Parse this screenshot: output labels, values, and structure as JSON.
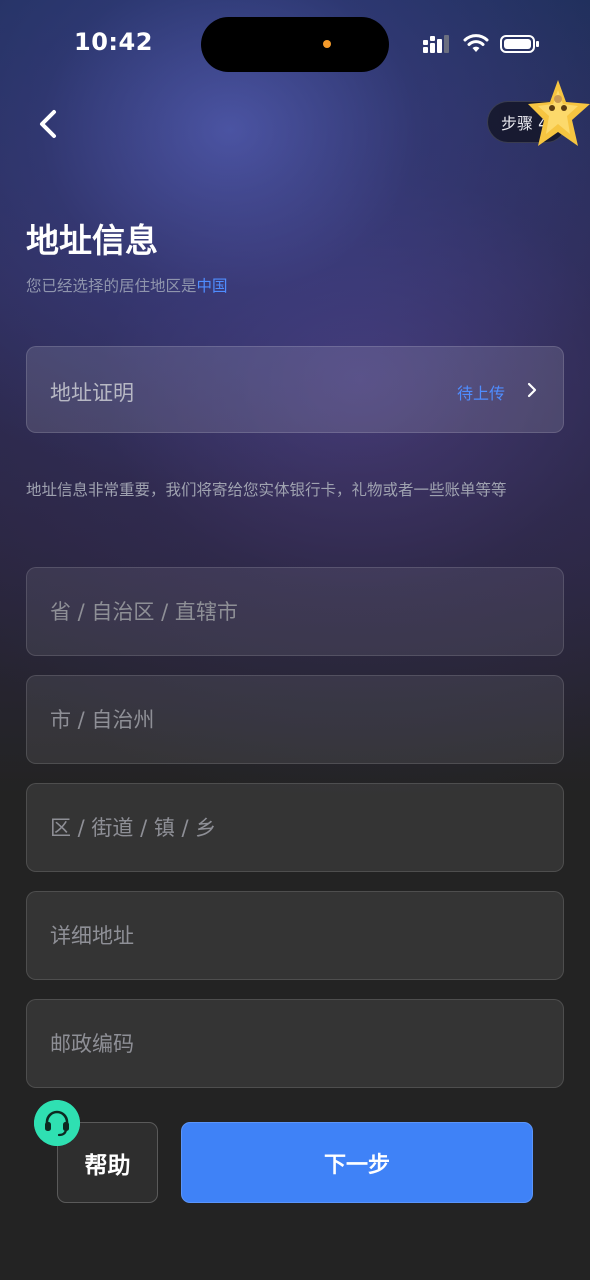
{
  "status_bar": {
    "time": "10:42"
  },
  "header": {
    "step_label": "步骤 4"
  },
  "page": {
    "title": "地址信息",
    "subtitle_prefix": "您已经选择的居住地区是",
    "country": "中国"
  },
  "address_proof": {
    "label": "地址证明",
    "status": "待上传"
  },
  "note": "地址信息非常重要，我们将寄给您实体银行卡，礼物或者一些账单等等",
  "fields": {
    "province": {
      "placeholder": "省 / 自治区 / 直辖市",
      "value": ""
    },
    "city": {
      "placeholder": "市 / 自治州",
      "value": ""
    },
    "district": {
      "placeholder": "区 / 街道 / 镇 / 乡",
      "value": ""
    },
    "detail": {
      "placeholder": "详细地址",
      "value": ""
    },
    "postcode": {
      "placeholder": "邮政编码",
      "value": ""
    }
  },
  "footer": {
    "help_label": "帮助",
    "next_label": "下一步"
  },
  "colors": {
    "accent": "#4f8dff",
    "primary_button": "#3f82f7",
    "support": "#2fe0b2"
  },
  "icons": {
    "back": "chevron-left-icon",
    "proof_arrow": "chevron-right-icon",
    "support": "headset-icon",
    "mascot": "star-mascot-icon"
  }
}
